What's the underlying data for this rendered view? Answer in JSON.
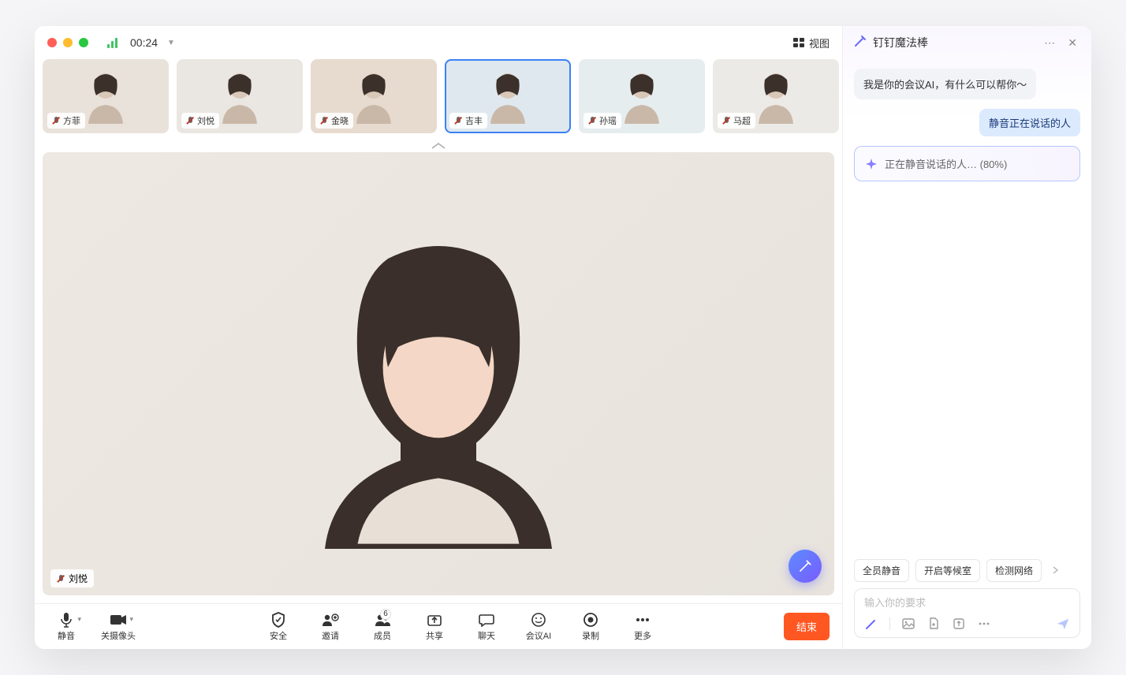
{
  "header": {
    "timer": "00:24",
    "view_label": "视图"
  },
  "participants": [
    {
      "name": "方菲",
      "muted": true,
      "bg": "#e9e2db"
    },
    {
      "name": "刘悦",
      "muted": true,
      "bg": "#eae6e1"
    },
    {
      "name": "金晓",
      "muted": true,
      "bg": "#e7dbcf"
    },
    {
      "name": "吉丰",
      "muted": true,
      "bg": "#dfe8ee",
      "active": true
    },
    {
      "name": "孙瑶",
      "muted": true,
      "bg": "#e6edef"
    },
    {
      "name": "马超",
      "muted": true,
      "bg": "#eceae6"
    }
  ],
  "main_speaker": {
    "name": "刘悦",
    "muted": true
  },
  "controls": {
    "mute": "静音",
    "camera": "关摄像头",
    "security": "安全",
    "invite": "邀请",
    "members": "成员",
    "members_count": "6",
    "share": "共享",
    "chat": "聊天",
    "meeting_ai": "会议AI",
    "record": "录制",
    "more": "更多",
    "end": "结束"
  },
  "sidebar": {
    "title": "钉钉魔法棒",
    "ai_msg": "我是你的会议AI，有什么可以帮你～",
    "user_msg": "静音正在说话的人",
    "progress_text": "正在静音说话的人… (80%)",
    "chips": [
      "全员静音",
      "开启等候室",
      "检测网络"
    ],
    "input_placeholder": "输入你的要求"
  }
}
